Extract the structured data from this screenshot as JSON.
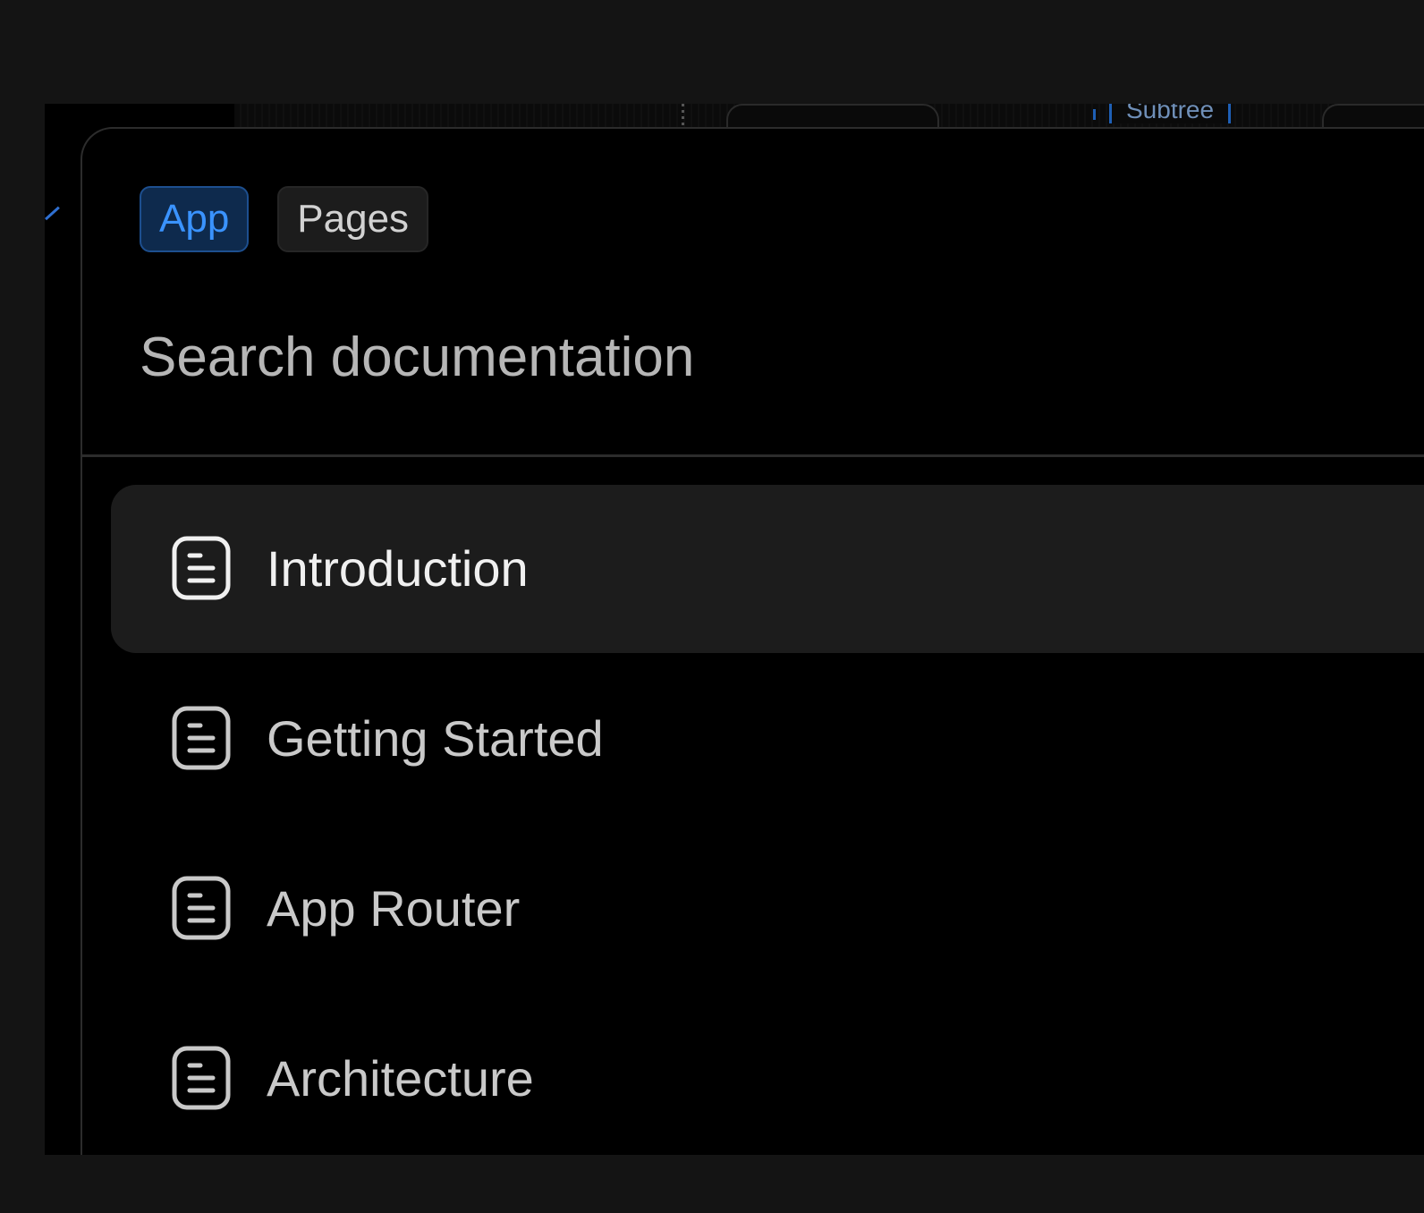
{
  "background": {
    "subtree_label": "Subtree"
  },
  "search": {
    "scopes": [
      {
        "label": "App",
        "active": true
      },
      {
        "label": "Pages",
        "active": false
      }
    ],
    "placeholder": "Search documentation"
  },
  "results": [
    {
      "label": "Introduction",
      "icon": "document-icon",
      "selected": true
    },
    {
      "label": "Getting Started",
      "icon": "document-icon",
      "selected": false
    },
    {
      "label": "App Router",
      "icon": "document-icon",
      "selected": false
    },
    {
      "label": "Architecture",
      "icon": "document-icon",
      "selected": false
    }
  ],
  "colors": {
    "accent": "#3a93ff",
    "accent_bg": "#0e2a4d",
    "selected_bg": "#1c1c1c",
    "modal_bg": "#000000",
    "page_bg": "#141414"
  }
}
